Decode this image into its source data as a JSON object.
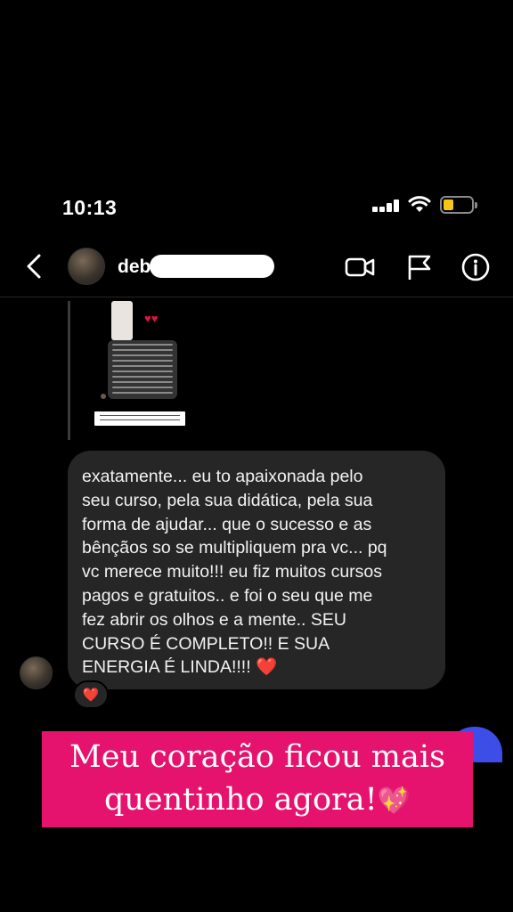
{
  "status_bar": {
    "time": "10:13"
  },
  "header": {
    "username": "deb"
  },
  "messages": {
    "received_lines": [
      "exatamente... eu to apaixonada pelo",
      "seu curso, pela sua didática,  pela sua",
      "forma de ajudar... que o sucesso e as",
      "bênçãos so se multipliquem pra vc... pq",
      "vc merece muito!!! eu fiz muitos cursos",
      "pagos e gratuitos.. e foi o seu que me",
      "fez abrir os olhos e a mente.. SEU",
      "CURSO É COMPLETO!!  E SUA",
      "ENERGIA É LINDA!!!! "
    ],
    "heart_emoji": "❤️",
    "reaction": "❤️"
  },
  "banner": {
    "line1": "Meu coração ficou mais",
    "line2": "quentinho agora!",
    "emoji": "💖"
  },
  "colors": {
    "banner_bg": "#e5136d",
    "bubble_bg": "#262626",
    "battery_fill": "#f5c518"
  }
}
